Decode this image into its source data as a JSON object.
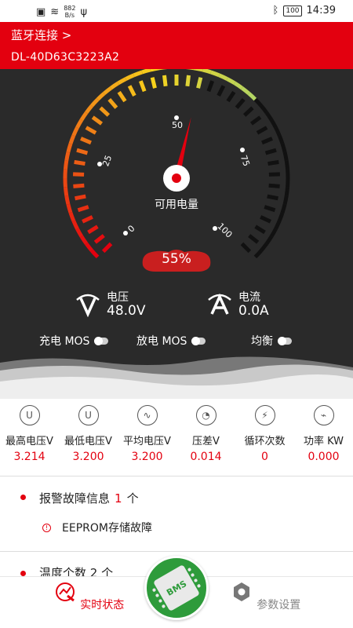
{
  "status_bar": {
    "net_speed_value": "882",
    "net_speed_unit": "B/s",
    "battery": "100",
    "time": "14:39"
  },
  "header": {
    "title": "蓝牙连接 >",
    "device_id": "DL-40D63C3223A2"
  },
  "gauge": {
    "label": "可用电量",
    "percent": "55%",
    "percent_value": 55,
    "ticks": [
      "0",
      "25",
      "50",
      "75",
      "100"
    ],
    "colors": {
      "low": "#e3000f",
      "mid": "#f7d21c",
      "high": "#3bd9e0",
      "track": "#111111"
    }
  },
  "metrics": {
    "voltage": {
      "label": "电压",
      "value": "48.0V",
      "icon": "voltage-icon"
    },
    "current": {
      "label": "电流",
      "value": "0.0A",
      "icon": "current-icon"
    }
  },
  "toggles": [
    {
      "label": "充电 MOS"
    },
    {
      "label": "放电 MOS"
    },
    {
      "label": "均衡"
    }
  ],
  "stats": [
    {
      "label": "最高电压V",
      "value": "3.214",
      "icon": "max-voltage-icon"
    },
    {
      "label": "最低电压V",
      "value": "3.200",
      "icon": "min-voltage-icon"
    },
    {
      "label": "平均电压V",
      "value": "3.200",
      "icon": "avg-voltage-icon"
    },
    {
      "label": "压差V",
      "value": "0.014",
      "icon": "voltage-diff-icon"
    },
    {
      "label": "循环次数",
      "value": "0",
      "icon": "cycle-icon"
    },
    {
      "label": "功率 KW",
      "value": "0.000",
      "icon": "power-icon"
    }
  ],
  "alarm": {
    "title": "报警故障信息",
    "count": "1",
    "unit": "个",
    "items": [
      "EEPROM存储故障"
    ]
  },
  "temperature": {
    "title": "温度个数 2 个"
  },
  "tabbar": {
    "realtime": "实时状态",
    "center": "BMS",
    "settings": "参数设置"
  },
  "colors": {
    "accent": "#e3000f",
    "dark_bg": "#2a2a2a",
    "bms_green": "#2e9b3b"
  }
}
